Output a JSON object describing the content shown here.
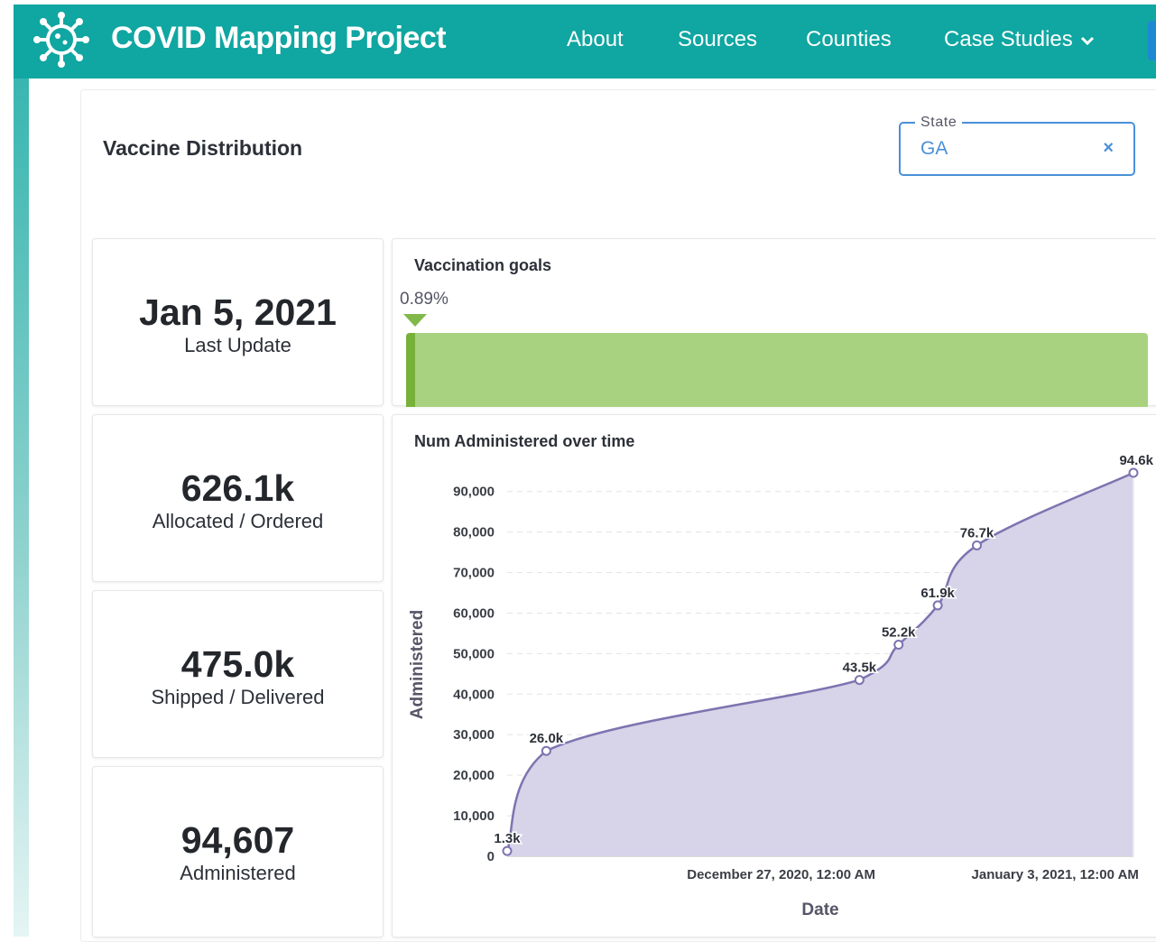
{
  "navbar": {
    "brand": "COVID Mapping Project",
    "links": [
      "About",
      "Sources",
      "Counties",
      "Case Studies"
    ],
    "brand_color": "#10a6a1"
  },
  "page": {
    "title": "Vaccine Distribution"
  },
  "state_filter": {
    "legend": "State",
    "value": "GA",
    "clear_label": "×"
  },
  "stats": [
    {
      "value": "Jan 5, 2021",
      "label": "Last Update"
    },
    {
      "value": "626.1k",
      "label": "Allocated / Ordered"
    },
    {
      "value": "475.0k",
      "label": "Shipped / Delivered"
    },
    {
      "value": "94,607",
      "label": "Administered"
    }
  ],
  "goals": {
    "title": "Vaccination goals",
    "percent_text": "0.89%",
    "percent": 0.89,
    "bar_color": "#a9d280",
    "marker_color": "#82b84a"
  },
  "chart_title": "Num Administered over time",
  "chart_data": {
    "type": "area",
    "xlabel": "Date",
    "ylabel": "Administered",
    "x_tick_labels": [
      "December 27, 2020, 12:00 AM",
      "January 3, 2021, 12:00 AM"
    ],
    "x_ticks": [
      "2020-12-27",
      "2021-01-03"
    ],
    "y_ticks": [
      0,
      10000,
      20000,
      30000,
      40000,
      50000,
      60000,
      70000,
      80000,
      90000
    ],
    "y_tick_labels": [
      "0",
      "10,000",
      "20,000",
      "30,000",
      "40,000",
      "50,000",
      "60,000",
      "70,000",
      "80,000",
      "90,000"
    ],
    "ylim": [
      0,
      94607
    ],
    "xlim": [
      "2020-12-20",
      "2021-01-05"
    ],
    "grid": true,
    "color": "#7c74b0",
    "fill": "#d7d3e8",
    "points": [
      {
        "x": "2020-12-20",
        "y": 1300,
        "label": "1.3k"
      },
      {
        "x": "2020-12-21",
        "y": 26000,
        "label": "26.0k"
      },
      {
        "x": "2020-12-29",
        "y": 43500,
        "label": "43.5k"
      },
      {
        "x": "2020-12-30",
        "y": 52200,
        "label": "52.2k"
      },
      {
        "x": "2020-12-31",
        "y": 61900,
        "label": "61.9k"
      },
      {
        "x": "2021-01-01",
        "y": 76700,
        "label": "76.7k"
      },
      {
        "x": "2021-01-05",
        "y": 94607,
        "label": "94.6k"
      }
    ]
  }
}
